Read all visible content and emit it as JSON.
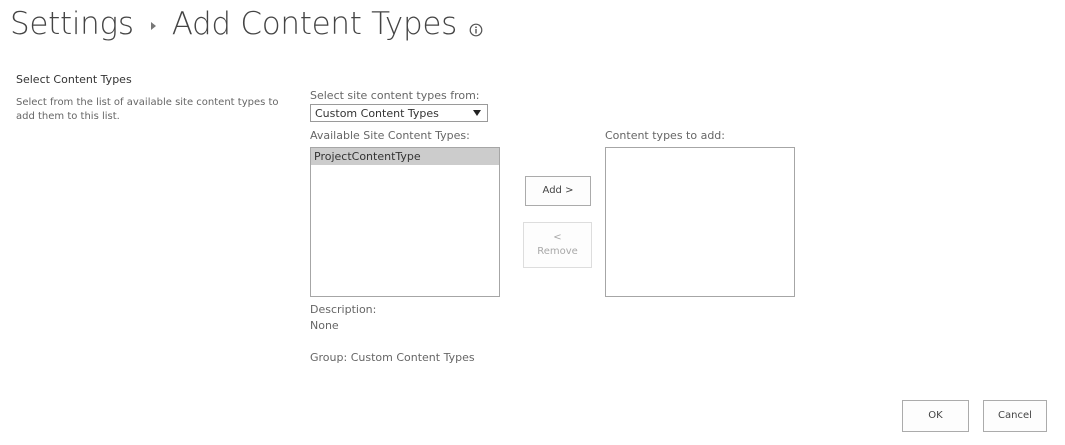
{
  "page": {
    "breadcrumb_parent": "Settings",
    "title": "Add Content Types"
  },
  "section": {
    "title": "Select Content Types",
    "description": "Select from the list of available site content types to add them to this list."
  },
  "form": {
    "source_label": "Select site content types from:",
    "source_selected": "Custom Content Types",
    "available_label": "Available Site Content Types:",
    "available_items": [
      "ProjectContentType"
    ],
    "to_add_label": "Content types to add:",
    "add_button": "Add >",
    "remove_arrow": "<",
    "remove_label": "Remove",
    "description_label": "Description:",
    "description_value": "None",
    "group_text": "Group: Custom Content Types"
  },
  "footer": {
    "ok_label": "OK",
    "cancel_label": "Cancel"
  },
  "icons": {
    "separator": "breadcrumb-separator-icon",
    "info": "info-icon",
    "dropdown": "chevron-down-icon"
  }
}
